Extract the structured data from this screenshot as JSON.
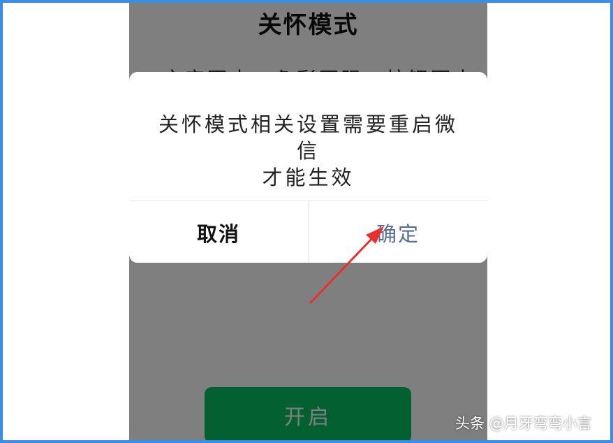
{
  "page": {
    "title": "关怀模式",
    "description": "文字更大、色彩更强、按钮更大，还",
    "enable_button": "开启"
  },
  "dialog": {
    "message_line1": "关怀模式相关设置需要重启微信",
    "message_line2": "才能生效",
    "cancel_label": "取消",
    "confirm_label": "确定"
  },
  "annotation": {
    "arrow_color": "#e8312f"
  },
  "watermark": "头条 @月牙弯弯小言",
  "colors": {
    "accent_green": "#07c160",
    "link_blue": "#576b95",
    "frame_blue": "#3a8ee6"
  }
}
